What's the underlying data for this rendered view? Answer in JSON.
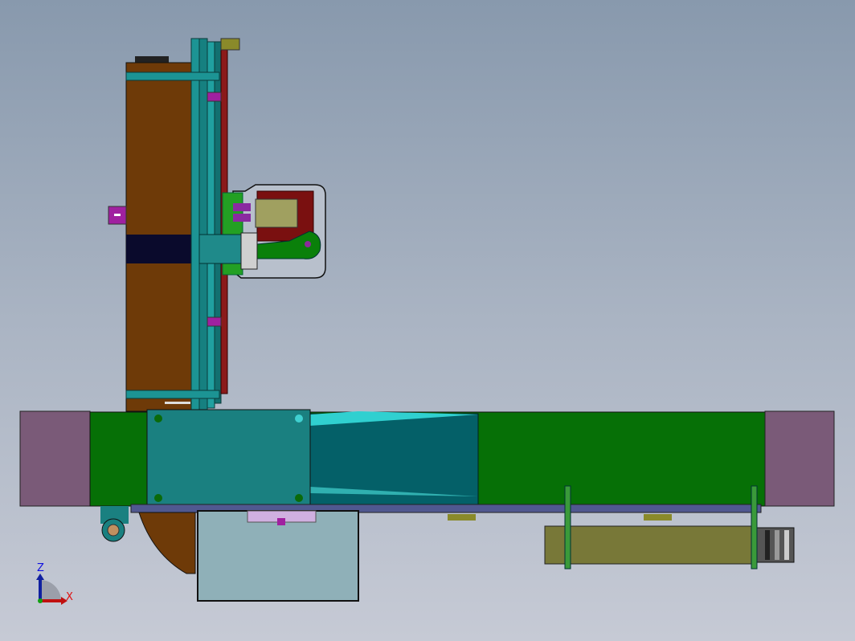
{
  "viewport": {
    "triad": {
      "z_label": "Z",
      "x_label": "X"
    }
  },
  "colors": {
    "background_top": "#8899ad",
    "background_bottom": "#c6cad5",
    "column_brown": "#6e3a08",
    "rail_teal": "#1c9494",
    "beam_green": "#067006",
    "end_cap_purple": "#7a5a78",
    "plate_teal": "#1a8080",
    "motor_olive": "#787838",
    "gripper_red": "#7a1010"
  }
}
